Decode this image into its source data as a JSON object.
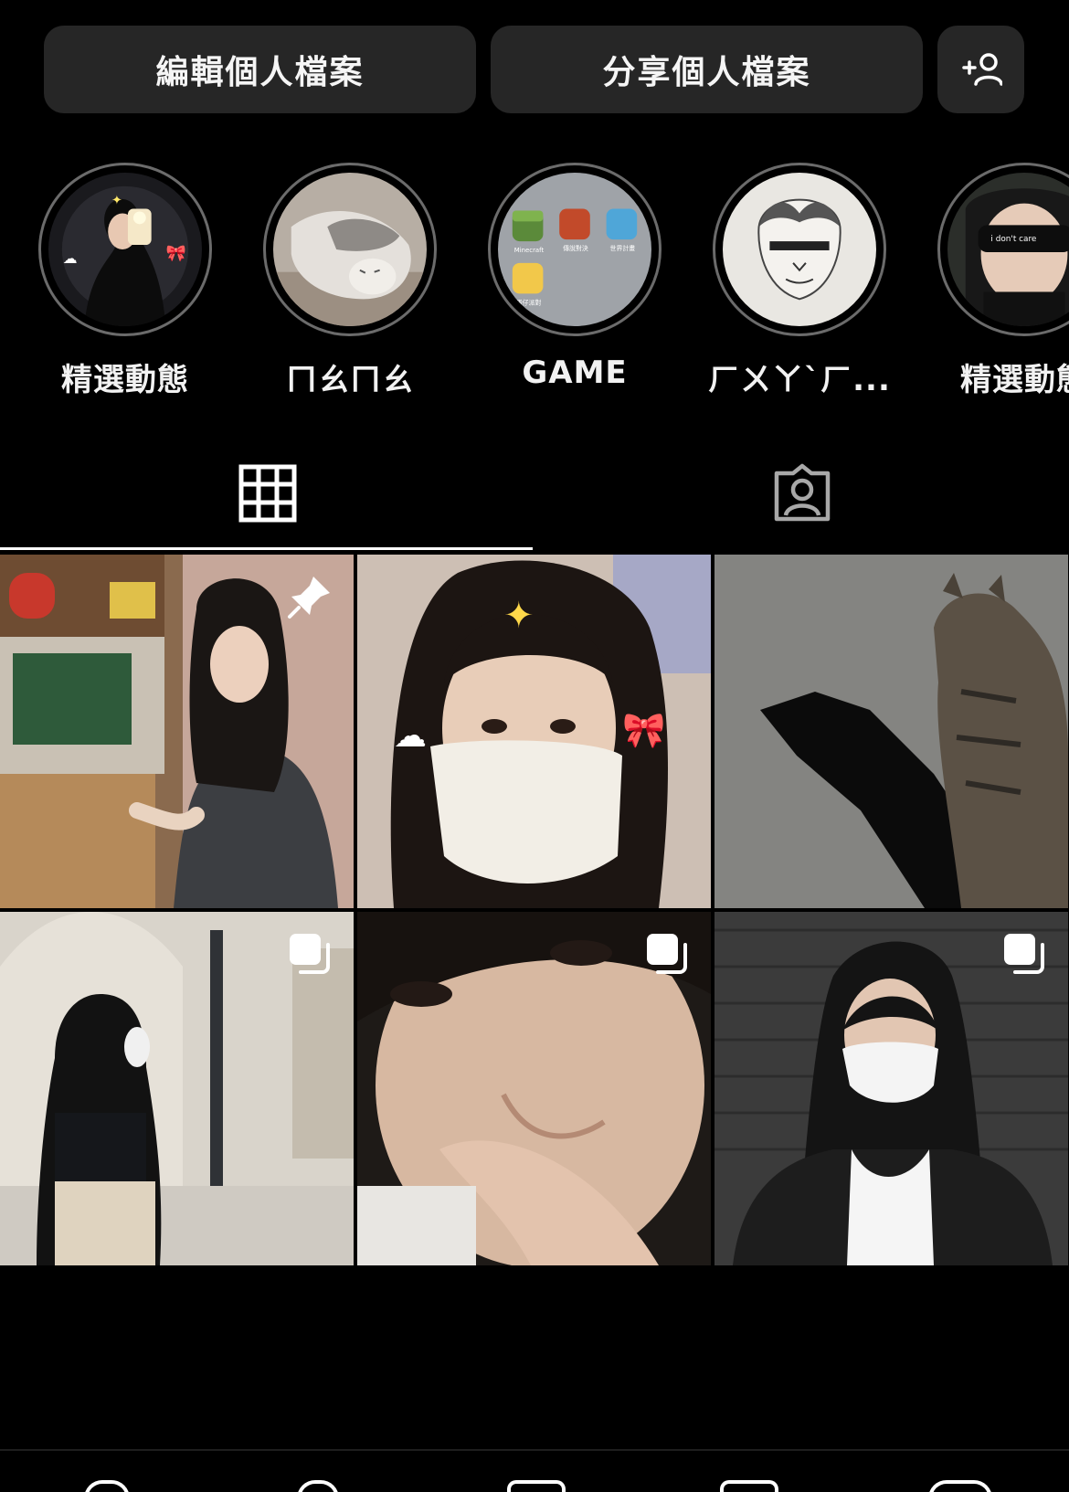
{
  "actions": {
    "edit_label": "編輯個人檔案",
    "share_label": "分享個人檔案",
    "add_icon": "add-person-icon"
  },
  "highlights": [
    {
      "label": "精選動態"
    },
    {
      "label": "ㄇㄠㄇㄠ"
    },
    {
      "label": "GAME",
      "app_names": [
        "Minecraft",
        "傳說對決",
        "世界計畫",
        "蛋仔派對"
      ]
    },
    {
      "label": "ㄏㄨㄚˋㄏ..."
    },
    {
      "label": "精選動態",
      "sticker_text": "i don't care"
    }
  ],
  "tabs": [
    {
      "name": "posts",
      "icon": "grid-icon",
      "active": true
    },
    {
      "name": "tagged",
      "icon": "tagged-person-icon",
      "active": false
    }
  ],
  "posts": [
    {
      "badge": "pin-icon"
    },
    {
      "badge": null
    },
    {
      "badge": null
    },
    {
      "badge": "multiple-photos-icon"
    },
    {
      "badge": "multiple-photos-icon"
    },
    {
      "badge": "multiple-photos-icon"
    }
  ],
  "colors": {
    "background": "#000000",
    "button": "#262626",
    "ring": "#6b6b6b",
    "text": "#f5f5f5"
  }
}
